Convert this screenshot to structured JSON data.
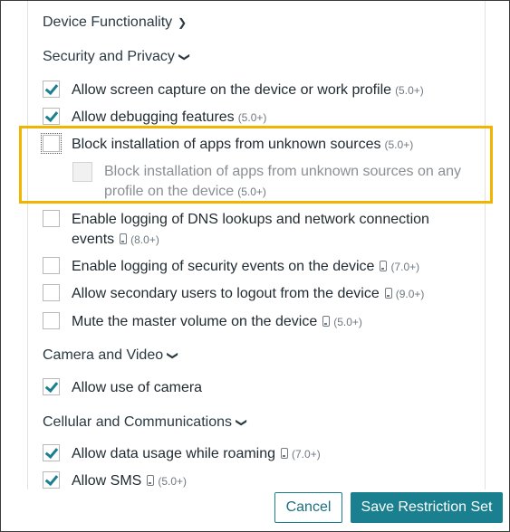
{
  "sections": {
    "device_functionality": "Device Functionality",
    "security_privacy": "Security and Privacy",
    "camera_video": "Camera and Video",
    "cellular": "Cellular and Communications"
  },
  "options": {
    "screen_capture": {
      "label": "Allow screen capture on the device or work profile",
      "version": "(5.0+)",
      "checked": true
    },
    "debugging": {
      "label": "Allow debugging features",
      "version": "(5.0+)",
      "checked": true
    },
    "block_unknown": {
      "label": "Block installation of apps from unknown sources",
      "version": "(5.0+)",
      "checked": false
    },
    "block_unknown_any_line1": "Block installation of apps from unknown sources on any",
    "block_unknown_any_line2": "profile on the device",
    "block_unknown_any_version": "(5.0+)",
    "dns_logging_line1": "Enable logging of DNS lookups and network connection",
    "dns_logging_line2": "events",
    "dns_logging_version": "(8.0+)",
    "security_logging": {
      "label": "Enable logging of security events on the device",
      "version": "(7.0+)"
    },
    "secondary_logout": {
      "label": "Allow secondary users to logout from the device",
      "version": "(9.0+)"
    },
    "mute_volume": {
      "label": "Mute the master volume on the device",
      "version": "(5.0+)"
    },
    "use_camera": {
      "label": "Allow use of camera",
      "checked": true
    },
    "data_roaming": {
      "label": "Allow data usage while roaming",
      "version": "(7.0+)",
      "checked": true
    },
    "sms": {
      "label": "Allow SMS",
      "version": "(5.0+)",
      "checked": true
    }
  },
  "buttons": {
    "cancel": "Cancel",
    "save": "Save Restriction Set"
  },
  "colors": {
    "accent": "#1a7f8f",
    "highlight": "#f3b400"
  }
}
